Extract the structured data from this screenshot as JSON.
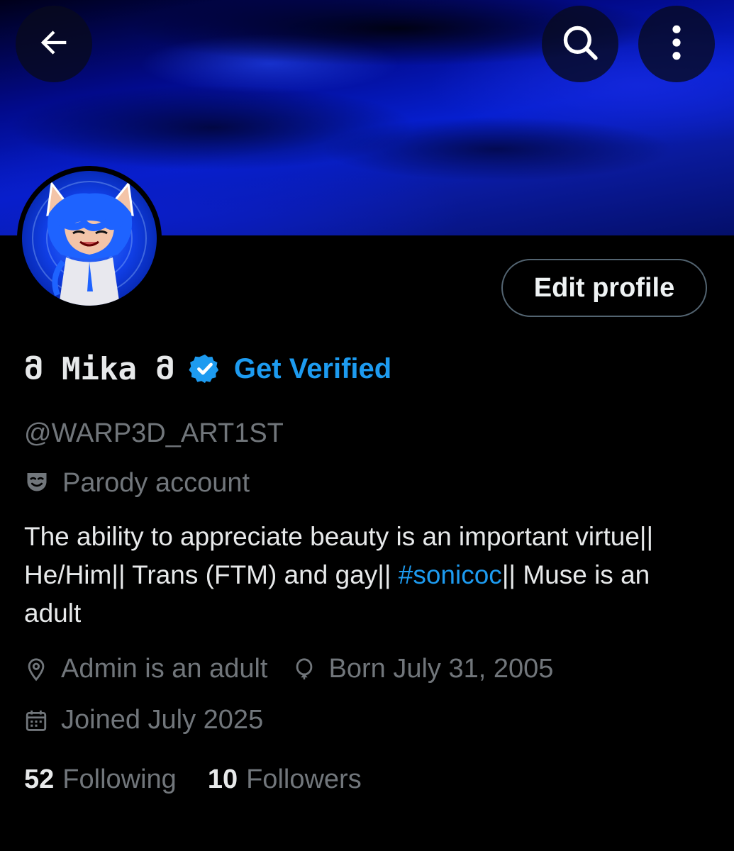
{
  "header": {
    "back_icon": "arrow-left-icon",
    "search_icon": "search-icon",
    "more_icon": "more-vertical-icon"
  },
  "profile": {
    "display_name": "მ Mika მ",
    "verified_icon": "verified-badge-icon",
    "get_verified_label": "Get Verified",
    "handle": "@WARP3D_ART1ST",
    "parody_label": "Parody account",
    "parody_icon": "theater-mask-icon",
    "bio_part1": "The ability to appreciate beauty is an important virtue|| He/Him|| Trans (FTM) and gay|| ",
    "bio_hashtag": "#sonicoc",
    "bio_part2": "|| Muse is an adult",
    "location": "Admin is an adult",
    "location_icon": "location-pin-icon",
    "birthday": "Born July 31, 2005",
    "birthday_icon": "balloon-icon",
    "joined": "Joined July 2025",
    "joined_icon": "calendar-icon",
    "following_count": "52",
    "following_label": "Following",
    "followers_count": "10",
    "followers_label": "Followers"
  },
  "actions": {
    "edit_profile_label": "Edit profile"
  },
  "colors": {
    "background": "#000000",
    "accent": "#1d9bf0",
    "secondary_text": "#71767b",
    "primary_text": "#e7e9ea"
  }
}
